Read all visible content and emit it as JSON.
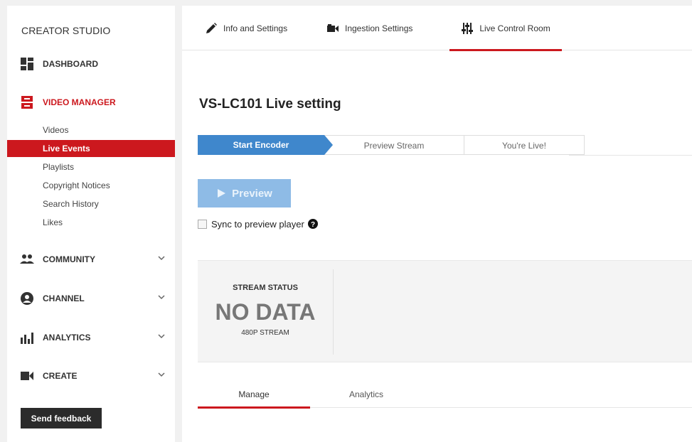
{
  "sidebar": {
    "brand": "CREATOR STUDIO",
    "items": [
      {
        "label": "DASHBOARD"
      },
      {
        "label": "VIDEO MANAGER"
      },
      {
        "label": "COMMUNITY"
      },
      {
        "label": "CHANNEL"
      },
      {
        "label": "ANALYTICS"
      },
      {
        "label": "CREATE"
      }
    ],
    "video_manager_subitems": [
      "Videos",
      "Live Events",
      "Playlists",
      "Copyright Notices",
      "Search History",
      "Likes"
    ],
    "feedback_label": "Send feedback"
  },
  "tabs": [
    {
      "label": "Info and Settings",
      "icon": "pencil-icon"
    },
    {
      "label": "Ingestion Settings",
      "icon": "camera-icon"
    },
    {
      "label": "Live Control Room",
      "icon": "sliders-icon"
    }
  ],
  "page": {
    "title": "VS-LC101 Live setting",
    "steps": [
      "Start Encoder",
      "Preview Stream",
      "You're Live!"
    ],
    "preview_label": "Preview",
    "sync_label": "Sync to preview player",
    "stream_status_label": "STREAM STATUS",
    "stream_status_value": "NO DATA",
    "stream_quality": "480P STREAM",
    "subtabs": [
      "Manage",
      "Analytics"
    ]
  },
  "colors": {
    "accent_red": "#cc181e",
    "step_blue": "#3f87cc",
    "preview_blue": "#8ebbe6"
  }
}
